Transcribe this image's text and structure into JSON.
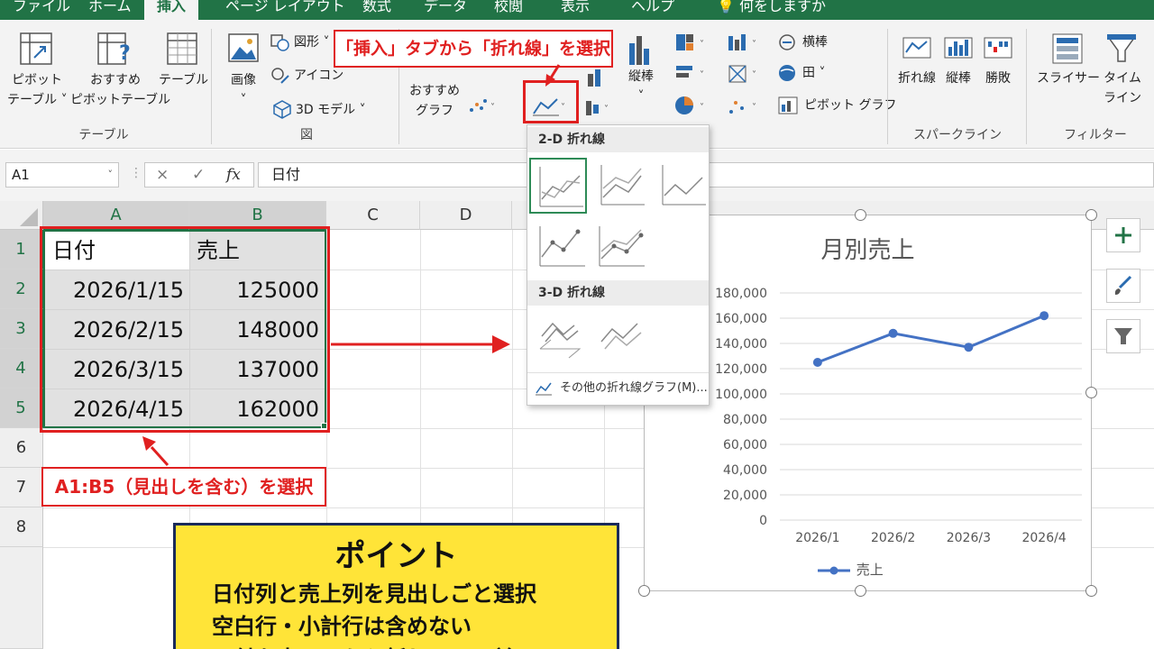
{
  "tabs": [
    {
      "label": "ファイル",
      "active": false
    },
    {
      "label": "ホーム",
      "active": false
    },
    {
      "label": "挿入",
      "active": true
    },
    {
      "label": "ページ レイアウト",
      "active": false
    },
    {
      "label": "数式",
      "active": false
    },
    {
      "label": "データ",
      "active": false
    },
    {
      "label": "校閲",
      "active": false
    },
    {
      "label": "表示",
      "active": false
    },
    {
      "label": "ヘルプ",
      "active": false
    }
  ],
  "tell_me": "何をしますか",
  "ribbon": {
    "table_group": {
      "pivot_table": [
        "ピボット",
        "テーブル"
      ],
      "recommended_pivot": [
        "おすすめ",
        "ピボットテーブル"
      ],
      "table": "テーブル",
      "group_label": "テーブル"
    },
    "illust_group": {
      "image": "画像",
      "shapes": "図形",
      "icons": "アイコン",
      "model3d": "3D モデル",
      "group_label": "図"
    },
    "chart_group": {
      "recommended_chart": [
        "おすすめ",
        "グラフ"
      ],
      "vertical": "縦棒",
      "horizontal": "横棒",
      "den": "田",
      "pivot_chart": "ピボット グラフ"
    },
    "sparkline_group": {
      "line": "折れ線",
      "column": "縦棒",
      "winloss": "勝敗",
      "group_label": "スパークライン"
    },
    "filter_group": {
      "slicer": "スライサー",
      "timeline": [
        "タイム",
        "ライン"
      ],
      "group_label": "フィルター"
    }
  },
  "formula_bar": {
    "name_box": "A1",
    "fx": "fx",
    "cancel": "×",
    "confirm": "✓",
    "value": "日付"
  },
  "columns": [
    "A",
    "B",
    "C",
    "D"
  ],
  "rows": [
    "1",
    "2",
    "3",
    "4",
    "5",
    "6",
    "7",
    "8"
  ],
  "table": {
    "headers": [
      "日付",
      "売上"
    ],
    "rows": [
      [
        "2026/1/15",
        "125000"
      ],
      [
        "2026/2/15",
        "148000"
      ],
      [
        "2026/3/15",
        "137000"
      ],
      [
        "2026/4/15",
        "162000"
      ]
    ]
  },
  "annotations": {
    "top": "「挿入」タブから「折れ線」を選択",
    "bottom": "A1:B5（見出しを含む）を選択"
  },
  "dropdown": {
    "section_2d": "2-D 折れ線",
    "section_3d": "3-D 折れ線",
    "more": "その他の折れ線グラフ(M)..."
  },
  "chart_data": {
    "type": "line",
    "title": "月別売上",
    "categories": [
      "2026/1",
      "2026/2",
      "2026/3",
      "2026/4"
    ],
    "series": [
      {
        "name": "売上",
        "values": [
          125000,
          148000,
          137000,
          162000
        ],
        "color": "#4472c4"
      }
    ],
    "ylim": [
      0,
      180000
    ],
    "yticks": [
      "0",
      "20,000",
      "40,000",
      "60,000",
      "80,000",
      "100,000",
      "120,000",
      "140,000",
      "160,000",
      "180,000"
    ],
    "grid": true,
    "legend": "bottom"
  },
  "point_box": {
    "title": "ポイント",
    "lines": [
      "日付列と売上列を見出しごと選択",
      "空白行・小計行は含めない",
      "日付を古い日から新しい日へ並べる"
    ]
  },
  "colors": {
    "excel_green": "#217346",
    "annotation_red": "#e02020",
    "point_yellow": "#ffe438"
  }
}
